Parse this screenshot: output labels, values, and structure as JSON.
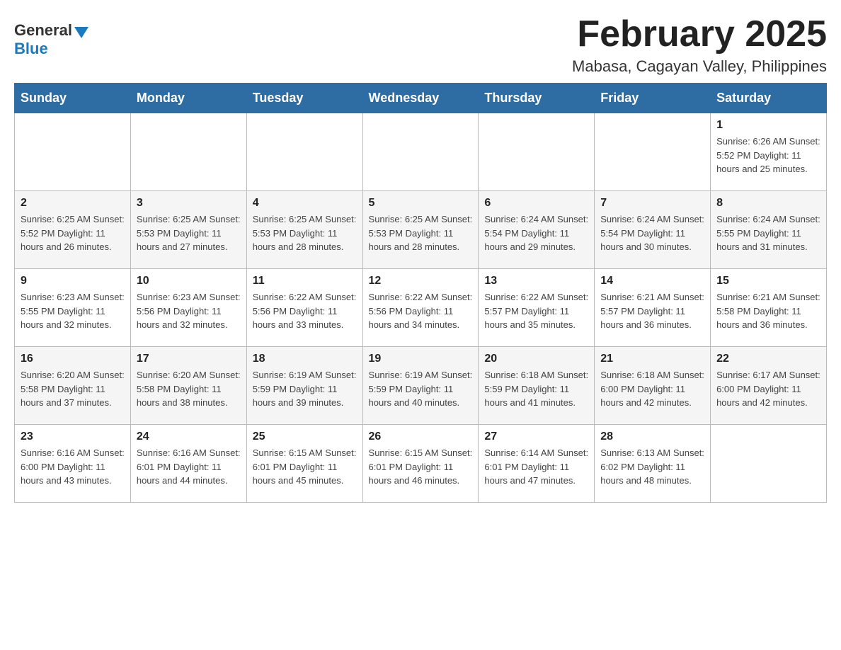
{
  "header": {
    "logo": {
      "general": "General",
      "blue": "Blue"
    },
    "title": "February 2025",
    "location": "Mabasa, Cagayan Valley, Philippines"
  },
  "days_of_week": [
    "Sunday",
    "Monday",
    "Tuesday",
    "Wednesday",
    "Thursday",
    "Friday",
    "Saturday"
  ],
  "weeks": [
    [
      {
        "day": "",
        "info": ""
      },
      {
        "day": "",
        "info": ""
      },
      {
        "day": "",
        "info": ""
      },
      {
        "day": "",
        "info": ""
      },
      {
        "day": "",
        "info": ""
      },
      {
        "day": "",
        "info": ""
      },
      {
        "day": "1",
        "info": "Sunrise: 6:26 AM\nSunset: 5:52 PM\nDaylight: 11 hours and 25 minutes."
      }
    ],
    [
      {
        "day": "2",
        "info": "Sunrise: 6:25 AM\nSunset: 5:52 PM\nDaylight: 11 hours and 26 minutes."
      },
      {
        "day": "3",
        "info": "Sunrise: 6:25 AM\nSunset: 5:53 PM\nDaylight: 11 hours and 27 minutes."
      },
      {
        "day": "4",
        "info": "Sunrise: 6:25 AM\nSunset: 5:53 PM\nDaylight: 11 hours and 28 minutes."
      },
      {
        "day": "5",
        "info": "Sunrise: 6:25 AM\nSunset: 5:53 PM\nDaylight: 11 hours and 28 minutes."
      },
      {
        "day": "6",
        "info": "Sunrise: 6:24 AM\nSunset: 5:54 PM\nDaylight: 11 hours and 29 minutes."
      },
      {
        "day": "7",
        "info": "Sunrise: 6:24 AM\nSunset: 5:54 PM\nDaylight: 11 hours and 30 minutes."
      },
      {
        "day": "8",
        "info": "Sunrise: 6:24 AM\nSunset: 5:55 PM\nDaylight: 11 hours and 31 minutes."
      }
    ],
    [
      {
        "day": "9",
        "info": "Sunrise: 6:23 AM\nSunset: 5:55 PM\nDaylight: 11 hours and 32 minutes."
      },
      {
        "day": "10",
        "info": "Sunrise: 6:23 AM\nSunset: 5:56 PM\nDaylight: 11 hours and 32 minutes."
      },
      {
        "day": "11",
        "info": "Sunrise: 6:22 AM\nSunset: 5:56 PM\nDaylight: 11 hours and 33 minutes."
      },
      {
        "day": "12",
        "info": "Sunrise: 6:22 AM\nSunset: 5:56 PM\nDaylight: 11 hours and 34 minutes."
      },
      {
        "day": "13",
        "info": "Sunrise: 6:22 AM\nSunset: 5:57 PM\nDaylight: 11 hours and 35 minutes."
      },
      {
        "day": "14",
        "info": "Sunrise: 6:21 AM\nSunset: 5:57 PM\nDaylight: 11 hours and 36 minutes."
      },
      {
        "day": "15",
        "info": "Sunrise: 6:21 AM\nSunset: 5:58 PM\nDaylight: 11 hours and 36 minutes."
      }
    ],
    [
      {
        "day": "16",
        "info": "Sunrise: 6:20 AM\nSunset: 5:58 PM\nDaylight: 11 hours and 37 minutes."
      },
      {
        "day": "17",
        "info": "Sunrise: 6:20 AM\nSunset: 5:58 PM\nDaylight: 11 hours and 38 minutes."
      },
      {
        "day": "18",
        "info": "Sunrise: 6:19 AM\nSunset: 5:59 PM\nDaylight: 11 hours and 39 minutes."
      },
      {
        "day": "19",
        "info": "Sunrise: 6:19 AM\nSunset: 5:59 PM\nDaylight: 11 hours and 40 minutes."
      },
      {
        "day": "20",
        "info": "Sunrise: 6:18 AM\nSunset: 5:59 PM\nDaylight: 11 hours and 41 minutes."
      },
      {
        "day": "21",
        "info": "Sunrise: 6:18 AM\nSunset: 6:00 PM\nDaylight: 11 hours and 42 minutes."
      },
      {
        "day": "22",
        "info": "Sunrise: 6:17 AM\nSunset: 6:00 PM\nDaylight: 11 hours and 42 minutes."
      }
    ],
    [
      {
        "day": "23",
        "info": "Sunrise: 6:16 AM\nSunset: 6:00 PM\nDaylight: 11 hours and 43 minutes."
      },
      {
        "day": "24",
        "info": "Sunrise: 6:16 AM\nSunset: 6:01 PM\nDaylight: 11 hours and 44 minutes."
      },
      {
        "day": "25",
        "info": "Sunrise: 6:15 AM\nSunset: 6:01 PM\nDaylight: 11 hours and 45 minutes."
      },
      {
        "day": "26",
        "info": "Sunrise: 6:15 AM\nSunset: 6:01 PM\nDaylight: 11 hours and 46 minutes."
      },
      {
        "day": "27",
        "info": "Sunrise: 6:14 AM\nSunset: 6:01 PM\nDaylight: 11 hours and 47 minutes."
      },
      {
        "day": "28",
        "info": "Sunrise: 6:13 AM\nSunset: 6:02 PM\nDaylight: 11 hours and 48 minutes."
      },
      {
        "day": "",
        "info": ""
      }
    ]
  ]
}
